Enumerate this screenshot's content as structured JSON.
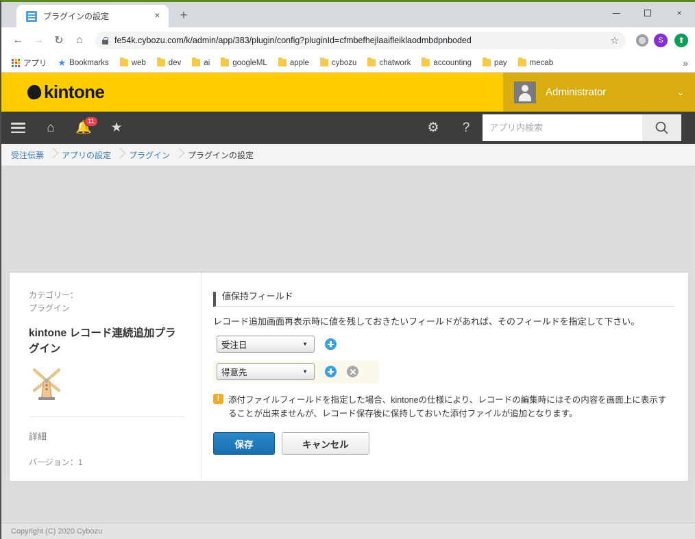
{
  "browser": {
    "tab": {
      "title": "プラグインの設定",
      "favicon": "document-icon",
      "close": "×"
    },
    "new_tab_label": "+",
    "window_controls": {
      "minimize": "minimize-icon",
      "maximize": "maximize-icon",
      "close": "×"
    },
    "nav": {
      "back": "←",
      "forward": "→",
      "reload": "↻",
      "home": "⌂"
    },
    "omnibox": {
      "url": "fe54k.cybozu.com/k/admin/app/383/plugin/config?pluginId=cfmbefhejlaaifleiklaodmbdpnboded",
      "lock_icon": "lock-icon",
      "star_icon": "☆",
      "extension_icon": "extension-icon",
      "profile_initial": "S",
      "update_icon": "⬆"
    },
    "bookmarks": [
      {
        "label": "アプリ",
        "icon": "apps-grid-icon"
      },
      {
        "label": "Bookmarks",
        "icon": "star-icon"
      },
      {
        "label": "web",
        "icon": "folder-icon"
      },
      {
        "label": "dev",
        "icon": "folder-icon"
      },
      {
        "label": "ai",
        "icon": "folder-icon"
      },
      {
        "label": "googleML",
        "icon": "folder-icon"
      },
      {
        "label": "apple",
        "icon": "folder-icon"
      },
      {
        "label": "cybozu",
        "icon": "folder-icon"
      },
      {
        "label": "chatwork",
        "icon": "folder-icon"
      },
      {
        "label": "accounting",
        "icon": "folder-icon"
      },
      {
        "label": "pay",
        "icon": "folder-icon"
      },
      {
        "label": "mecab",
        "icon": "folder-icon"
      }
    ],
    "bookmarks_overflow": "»"
  },
  "kintone": {
    "logo_text": "kintone",
    "user": {
      "name": "Administrator",
      "chevron": "⌄",
      "avatar": "user-avatar"
    },
    "toolbar": {
      "menu": "hamburger-icon",
      "home": "⌂",
      "notifications": "🔔",
      "notification_count": "11",
      "favorites": "★",
      "settings": "⚙",
      "help": "?",
      "search_placeholder": "アプリ内検索",
      "search_value": "",
      "search_button": "search-icon"
    },
    "breadcrumb": [
      {
        "label": "受注伝票",
        "current": false
      },
      {
        "label": "アプリの設定",
        "current": false
      },
      {
        "label": "プラグイン",
        "current": false
      },
      {
        "label": "プラグインの設定",
        "current": true
      }
    ],
    "plugin_info": {
      "category_label": "カテゴリー：",
      "category_value": "プラグイン",
      "title": "kintone レコード連続追加プラグイン",
      "icon": "windmill-icon",
      "detail_label": "詳細",
      "version": "バージョン：1"
    },
    "form": {
      "section_title": "値保持フィールド",
      "description": "レコード追加画面再表示時に値を残しておきたいフィールドがあれば、そのフィールドを指定して下さい。",
      "rows": [
        {
          "value": "受注日",
          "caret": "▼",
          "add": "add-icon",
          "removable": false,
          "highlight": false
        },
        {
          "value": "得意先",
          "caret": "▼",
          "add": "add-icon",
          "removable": true,
          "highlight": true
        }
      ],
      "warning_icon": "!",
      "warning_text": "添付ファイルフィールドを指定した場合、kintoneの仕様により、レコードの編集時にはその内容を画面上に表示することが出来ませんが、レコード保存後に保持しておいた添付ファイルが追加となります。",
      "save_label": "保存",
      "cancel_label": "キャンセル"
    },
    "footer": {
      "copyright": "Copyright (C) 2020 Cybozu"
    }
  },
  "colors": {
    "brand_yellow": "#ffcc00",
    "user_bar_gold": "#d9ad0f",
    "toolbar_dark": "#3d3d3d",
    "link_blue": "#3b7ab5",
    "primary_button": "#1a6fae",
    "badge_red": "#e8434b",
    "warning_orange": "#f0ad23",
    "page_gray": "#dedede",
    "highlight_row": "#fbf9ee"
  }
}
